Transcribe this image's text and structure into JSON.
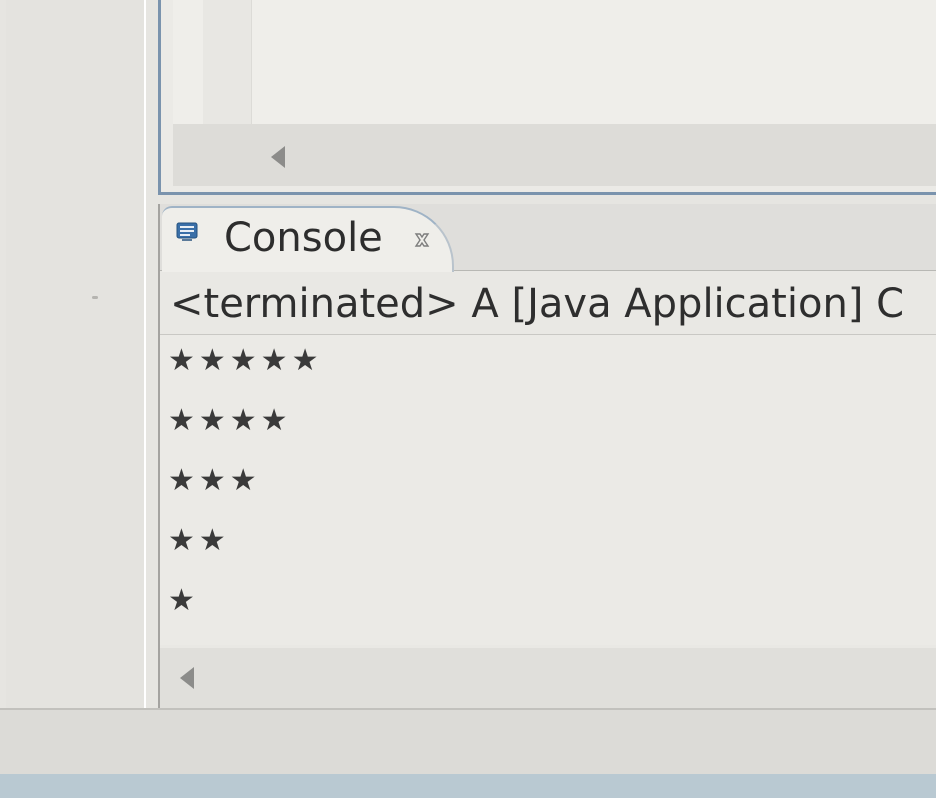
{
  "console": {
    "tab_label": "Console",
    "status_text": "<terminated> A [Java Application] C",
    "output_lines": [
      "★★★★★",
      "★★★★",
      "★★★",
      "★★",
      "★"
    ]
  },
  "icons": {
    "console_tab_icon": "console-icon",
    "close_icon": "close-icon",
    "editor_scroll_left": "scroll-left-arrow-icon",
    "console_scroll_left": "scroll-left-arrow-icon"
  },
  "colors": {
    "active_border": "#7a93ad",
    "text": "#2d2d2d"
  }
}
